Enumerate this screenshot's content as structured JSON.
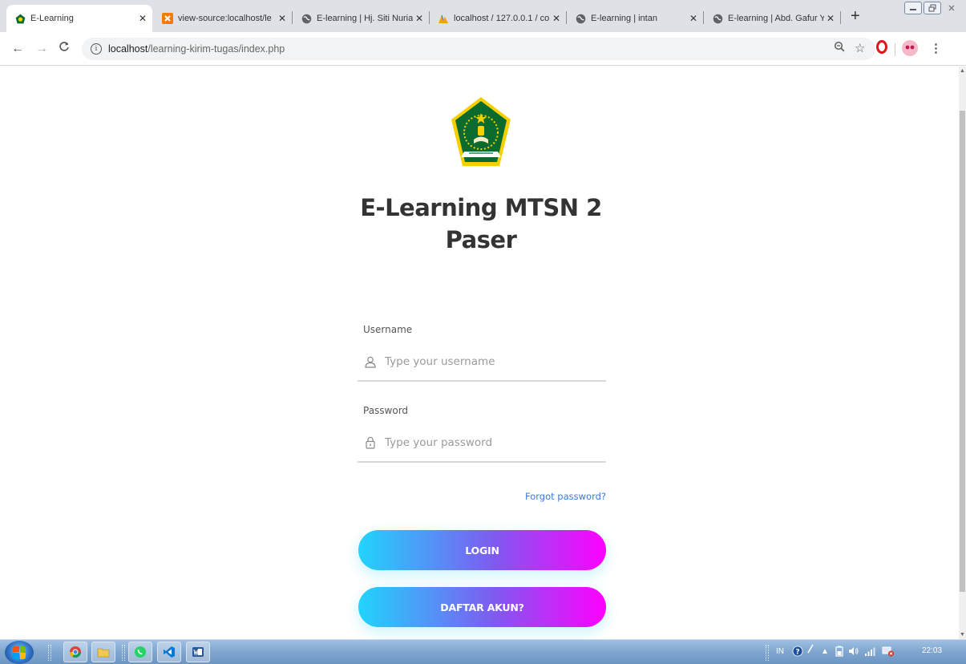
{
  "browser": {
    "tabs": [
      {
        "label": "E-Learning",
        "icon": "kemenag-logo-icon",
        "active": true
      },
      {
        "label": "view-source:localhost/le",
        "icon": "xampp-icon"
      },
      {
        "label": "E-learning | Hj. Siti Nuria",
        "icon": "globe-icon"
      },
      {
        "label": "localhost / 127.0.0.1 / co",
        "icon": "phpmyadmin-icon"
      },
      {
        "label": "E-learning | intan",
        "icon": "globe-icon"
      },
      {
        "label": "E-learning | Abd. Gafur Y",
        "icon": "globe-icon"
      }
    ],
    "tab_close": "✕",
    "new_tab": "+",
    "address": {
      "host": "localhost",
      "path": "/learning-kirim-tugas/index.php"
    }
  },
  "page": {
    "title_line1": "E-Learning MTSN 2",
    "title_line2": "Paser",
    "username": {
      "label": "Username",
      "placeholder": "Type your username"
    },
    "password": {
      "label": "Password",
      "placeholder": "Type your password"
    },
    "forgot": "Forgot password?",
    "login_button": "LOGIN",
    "register_button": "DAFTAR AKUN?"
  },
  "taskbar": {
    "language": "IN",
    "clock": "22:03"
  },
  "colors": {
    "gradient_start": "#21d4fd",
    "gradient_mid": "#7f5af0",
    "gradient_end": "#ff00ff",
    "link": "#3a7bd5",
    "logo_green": "#0b6b2f",
    "logo_gold": "#f4d000"
  }
}
